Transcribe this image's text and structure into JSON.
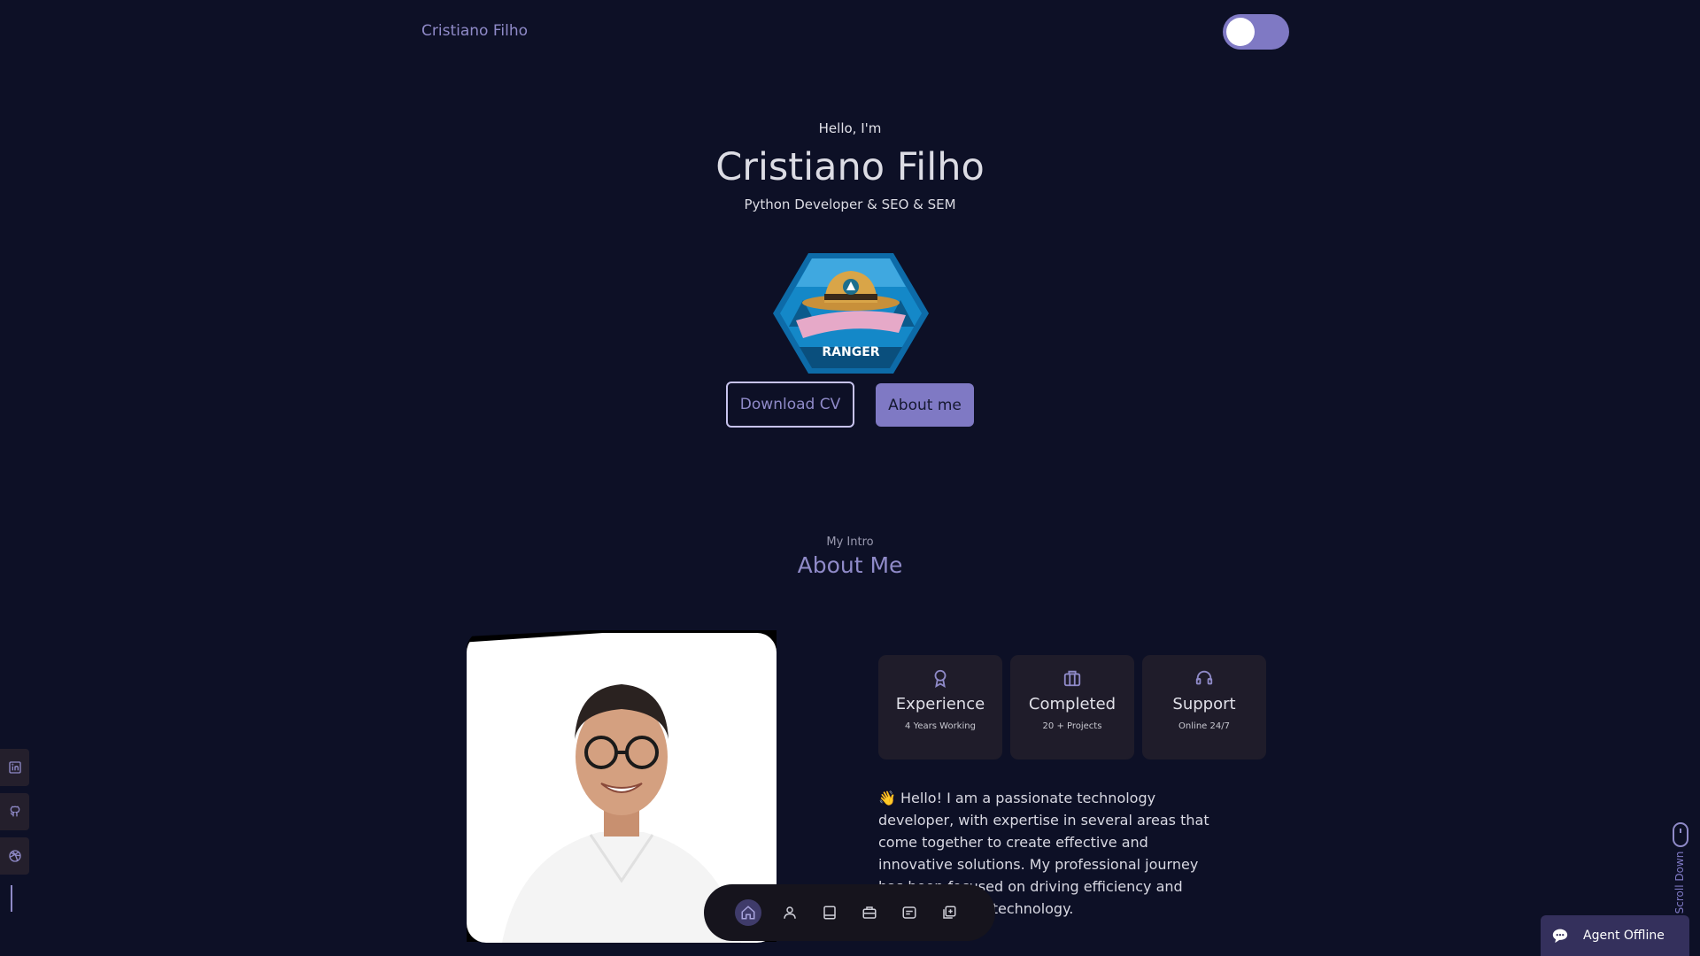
{
  "header": {
    "brand": "Cristiano Filho",
    "theme_toggle": "dark"
  },
  "hero": {
    "greeting": "Hello, I'm",
    "name": "Cristiano Filho",
    "role": "Python Developer & SEO & SEM",
    "badge_text": "RANGER",
    "download_cv": "Download CV",
    "about_me": "About me"
  },
  "about": {
    "subtitle": "My Intro",
    "title": "About Me",
    "cards": [
      {
        "icon": "award-icon",
        "title": "Experience",
        "subtitle": "4 Years Working"
      },
      {
        "icon": "briefcase-icon",
        "title": "Completed",
        "subtitle": "20 + Projects"
      },
      {
        "icon": "headset-icon",
        "title": "Support",
        "subtitle": "Online 24/7"
      }
    ],
    "text": "👋 Hello! I am a passionate technology developer, with expertise in several areas that come together to create effective and innovative solutions. My professional journey has been focused on driving efficiency and growth through technology."
  },
  "social": [
    "linkedin-icon",
    "github-icon",
    "dribbble-icon"
  ],
  "scroll": {
    "label": "Scroll Down"
  },
  "nav": {
    "items": [
      "home-icon",
      "user-icon",
      "book-icon",
      "briefcase-icon",
      "message-icon",
      "gallery-icon"
    ],
    "active": "home-icon"
  },
  "chat": {
    "label": "Agent Offline"
  },
  "colors": {
    "background": "#0d1026",
    "accent": "#7f79c4",
    "card": "#1f1c2a"
  }
}
